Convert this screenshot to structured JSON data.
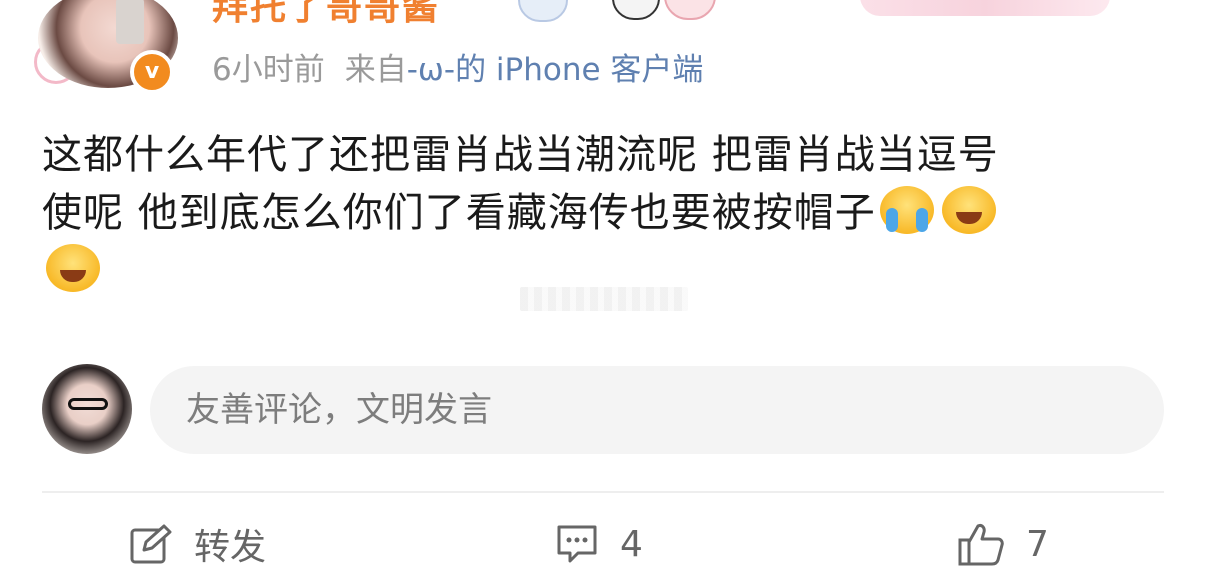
{
  "post": {
    "username": "拜托了哥哥酱",
    "time": "6小时前",
    "source_prefix": "来自",
    "source_client": "-ω-的 iPhone 客户端",
    "text_line1": "这都什么年代了还把雷肖战当潮流呢 把雷肖战当逗号",
    "text_line2": "使呢 他到底怎么你们了看藏海传也要被按帽子",
    "emojis": [
      "crying-face-icon",
      "laughing-face-icon",
      "laughing-face-icon"
    ]
  },
  "comment_box": {
    "placeholder": "友善评论，文明发言"
  },
  "actions": {
    "repost_label": "转发",
    "comment_count": "4",
    "like_count": "7"
  },
  "colors": {
    "username": "#f08030",
    "client_link": "#5f80b0",
    "meta_gray": "#9a9a9a",
    "verified_badge": "#f28b1f"
  }
}
